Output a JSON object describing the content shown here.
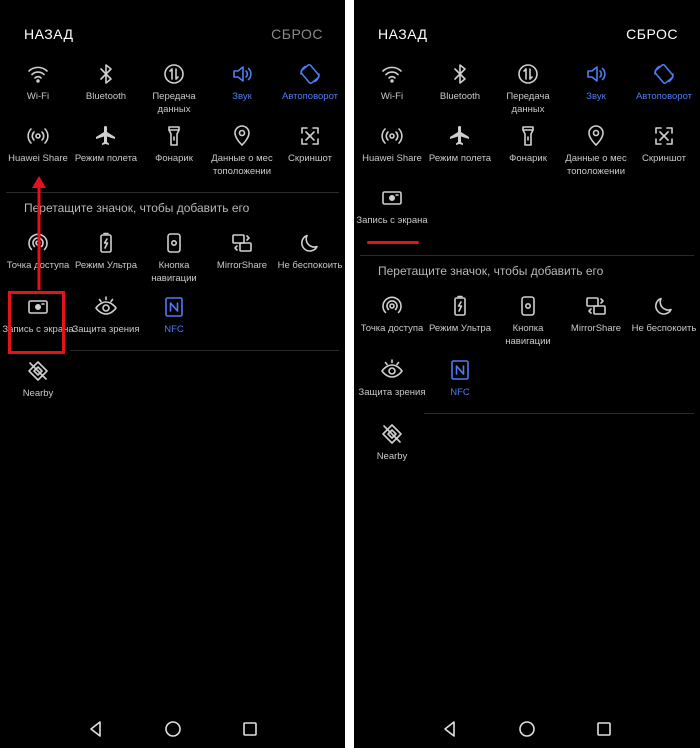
{
  "left": {
    "back_label": "НАЗАД",
    "reset_label": "СБРОС",
    "rows": [
      [
        {
          "label": "Wi-Fi",
          "icon": "wifi-icon",
          "active": false
        },
        {
          "label": "Bluetooth",
          "icon": "bluetooth-icon",
          "active": false
        },
        {
          "label": "Передача данных",
          "icon": "mobile-data-icon",
          "active": false
        },
        {
          "label": "Звук",
          "icon": "sound-icon",
          "active": true
        },
        {
          "label": "Автоповорот",
          "icon": "auto-rotate-icon",
          "active": true
        }
      ],
      [
        {
          "label": "Huawei Share",
          "icon": "huawei-share-icon",
          "active": false
        },
        {
          "label": "Режим полета",
          "icon": "airplane-icon",
          "active": false
        },
        {
          "label": "Фонарик",
          "icon": "flashlight-icon",
          "active": false
        },
        {
          "label": "Данные о мес тоположении",
          "icon": "location-icon",
          "active": false
        },
        {
          "label": "Скриншот",
          "icon": "screenshot-icon",
          "active": false
        }
      ]
    ],
    "hint": "Перетащите значок, чтобы добавить его",
    "extra_rows": [
      [
        {
          "label": "Точка доступа",
          "icon": "hotspot-icon",
          "active": false
        },
        {
          "label": "Режим Ультра",
          "icon": "ultra-battery-icon",
          "active": false
        },
        {
          "label": "Кнопка навигации",
          "icon": "nav-button-icon",
          "active": false
        },
        {
          "label": "MirrorShare",
          "icon": "mirrorshare-icon",
          "active": false
        },
        {
          "label": "Не беспокоить",
          "icon": "moon-icon",
          "active": false
        }
      ],
      [
        {
          "label": "Запись с экрана",
          "icon": "screen-record-icon",
          "active": false
        },
        {
          "label": "Защита зрения",
          "icon": "eye-icon",
          "active": false
        },
        {
          "label": "NFC",
          "icon": "nfc-icon",
          "active": true
        }
      ],
      [
        {
          "label": "Nearby",
          "icon": "nearby-icon",
          "active": false
        }
      ]
    ]
  },
  "right": {
    "back_label": "НАЗАД",
    "reset_label": "СБРОС",
    "rows": [
      [
        {
          "label": "Wi-Fi",
          "icon": "wifi-icon",
          "active": false
        },
        {
          "label": "Bluetooth",
          "icon": "bluetooth-icon",
          "active": false
        },
        {
          "label": "Передача данных",
          "icon": "mobile-data-icon",
          "active": false
        },
        {
          "label": "Звук",
          "icon": "sound-icon",
          "active": true
        },
        {
          "label": "Автоповорот",
          "icon": "auto-rotate-icon",
          "active": true
        }
      ],
      [
        {
          "label": "Huawei Share",
          "icon": "huawei-share-icon",
          "active": false
        },
        {
          "label": "Режим полета",
          "icon": "airplane-icon",
          "active": false
        },
        {
          "label": "Фонарик",
          "icon": "flashlight-icon",
          "active": false
        },
        {
          "label": "Данные о мес тоположении",
          "icon": "location-icon",
          "active": false
        },
        {
          "label": "Скриншот",
          "icon": "screenshot-icon",
          "active": false
        }
      ],
      [
        {
          "label": "Запись с экрана",
          "icon": "screen-record-icon",
          "active": false
        }
      ]
    ],
    "hint": "Перетащите значок, чтобы добавить его",
    "extra_rows": [
      [
        {
          "label": "Точка доступа",
          "icon": "hotspot-icon",
          "active": false
        },
        {
          "label": "Режим Ультра",
          "icon": "ultra-battery-icon",
          "active": false
        },
        {
          "label": "Кнопка навигации",
          "icon": "nav-button-icon",
          "active": false
        },
        {
          "label": "MirrorShare",
          "icon": "mirrorshare-icon",
          "active": false
        },
        {
          "label": "Не беспокоить",
          "icon": "moon-icon",
          "active": false
        }
      ],
      [
        {
          "label": "Защита зрения",
          "icon": "eye-icon",
          "active": false
        },
        {
          "label": "NFC",
          "icon": "nfc-icon",
          "active": true
        }
      ],
      [
        {
          "label": "Nearby",
          "icon": "nearby-icon",
          "active": false
        }
      ]
    ]
  },
  "navbar": {
    "back": "back-triangle-icon",
    "home": "home-circle-icon",
    "recents": "recents-square-icon"
  },
  "colors": {
    "background": "#000000",
    "label": "#c9c9c9",
    "active": "#4f7cf2",
    "annotation": "#e3121d"
  }
}
